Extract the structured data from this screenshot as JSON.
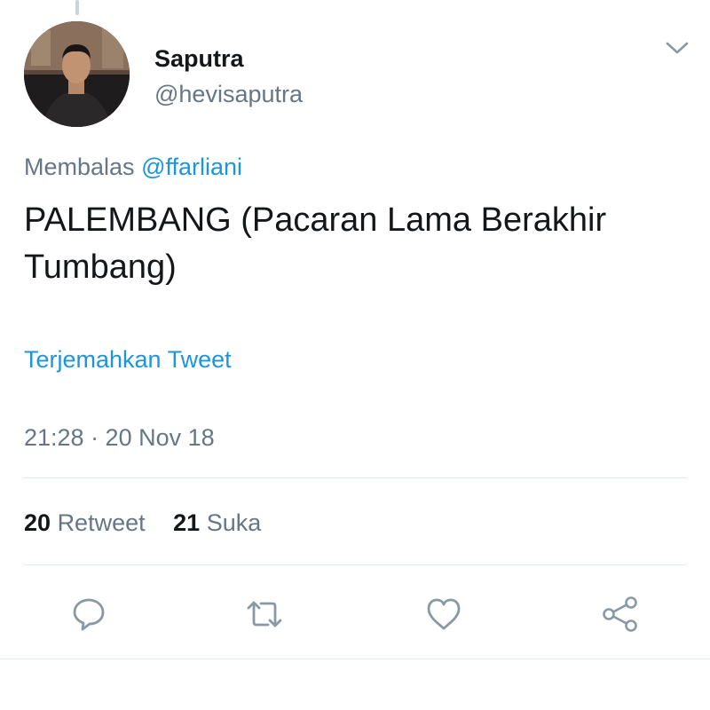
{
  "tweet": {
    "display_name": "Saputra",
    "handle": "@hevisaputra",
    "reply_prefix": "Membalas",
    "reply_to": "@ffarliani",
    "text": "PALEMBANG (Pacaran Lama Berakhir Tumbang)",
    "translate_label": "Terjemahkan Tweet",
    "timestamp": "21:28 · 20 Nov 18"
  },
  "stats": {
    "retweet_count": "20",
    "retweet_label": "Retweet",
    "like_count": "21",
    "like_label": "Suka"
  },
  "actions": [
    {
      "name": "reply",
      "icon": "reply-icon"
    },
    {
      "name": "retweet",
      "icon": "retweet-icon"
    },
    {
      "name": "like",
      "icon": "heart-icon"
    },
    {
      "name": "share",
      "icon": "share-icon"
    }
  ],
  "colors": {
    "text": "#14171a",
    "secondary": "#657786",
    "link": "#1b95e0",
    "divider": "#e1e8ed"
  }
}
